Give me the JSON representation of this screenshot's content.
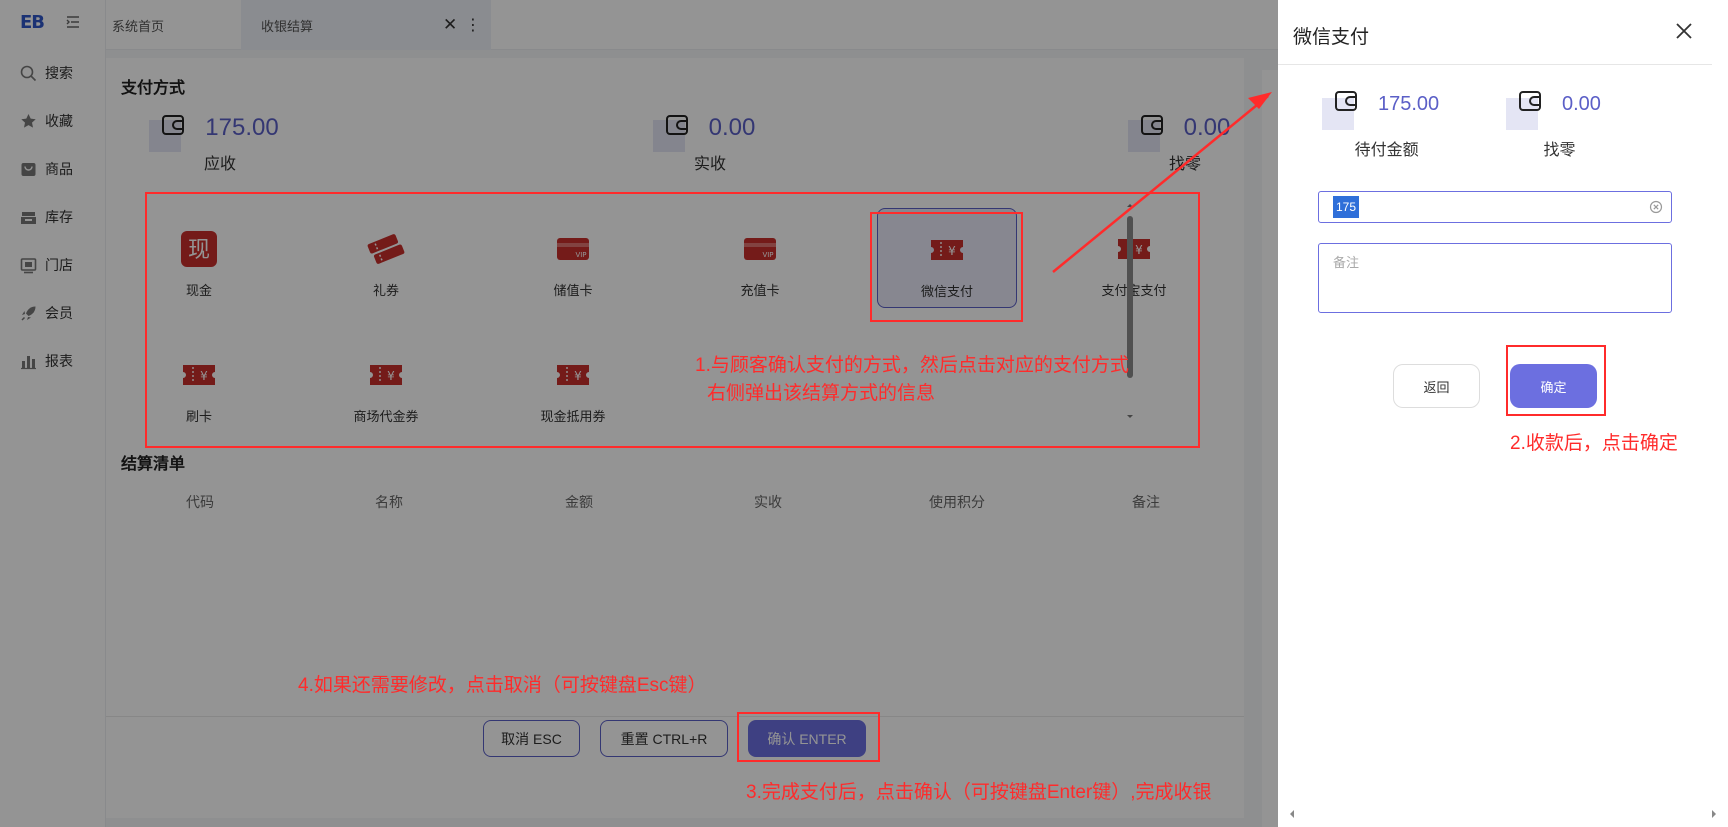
{
  "app": {
    "logo": "EB"
  },
  "sidebar": {
    "items": [
      {
        "label": "搜索",
        "icon": "search-icon"
      },
      {
        "label": "收藏",
        "icon": "star-icon"
      },
      {
        "label": "商品",
        "icon": "goods-icon"
      },
      {
        "label": "库存",
        "icon": "inventory-icon"
      },
      {
        "label": "门店",
        "icon": "store-icon"
      },
      {
        "label": "会员",
        "icon": "rocket-icon"
      },
      {
        "label": "报表",
        "icon": "chart-icon"
      }
    ]
  },
  "tabs": {
    "home": "系统首页",
    "active": "收银结算",
    "close": "✕",
    "more": "⋮"
  },
  "payment": {
    "title": "支付方式",
    "receivable": {
      "value": "175.00",
      "label": "应收"
    },
    "received": {
      "value": "0.00",
      "label": "实收"
    },
    "change": {
      "value": "0.00",
      "label": "找零"
    },
    "methods": [
      {
        "name": "现金",
        "icon": "cash-icon"
      },
      {
        "name": "礼券",
        "icon": "gift-coupon-icon"
      },
      {
        "name": "储值卡",
        "icon": "vip-card-icon"
      },
      {
        "name": "充值卡",
        "icon": "vip-card-icon"
      },
      {
        "name": "微信支付",
        "icon": "yen-ticket-icon"
      },
      {
        "name": "支付宝支付",
        "icon": "yen-ticket-icon"
      },
      {
        "name": "刷卡",
        "icon": "yen-ticket-icon"
      },
      {
        "name": "商场代金券",
        "icon": "yen-ticket-icon"
      },
      {
        "name": "现金抵用券",
        "icon": "yen-ticket-icon"
      }
    ],
    "cash_glyph": "现",
    "vip_text": "VIP",
    "yen": "¥"
  },
  "settlement": {
    "title": "结算清单",
    "columns": [
      "代码",
      "名称",
      "金额",
      "实收",
      "使用积分",
      "备注"
    ]
  },
  "buttons": {
    "cancel": "取消 ESC",
    "reset": "重置 CTRL+R",
    "confirm": "确认 ENTER"
  },
  "drawer": {
    "title": "微信支付",
    "due": {
      "value": "175.00",
      "label": "待付金额"
    },
    "change": {
      "value": "0.00",
      "label": "找零"
    },
    "amount_input": "175",
    "remark_placeholder": "备注",
    "back": "返回",
    "ok": "确定"
  },
  "annotations": {
    "step1_line1": "1.与顾客确认支付的方式，然后点击对应的支付方式",
    "step1_line2": "右侧弹出该结算方式的信息",
    "step2": "2.收款后，点击确定",
    "step3": "3.完成支付后，点击确认（可按键盘Enter键）,完成收银",
    "step4": "4.如果还需要修改，点击取消（可按键盘Esc键）"
  },
  "colors": {
    "accent": "#5b5fc7",
    "annotation": "#ff2b2b",
    "icon_red": "#c8302c"
  }
}
